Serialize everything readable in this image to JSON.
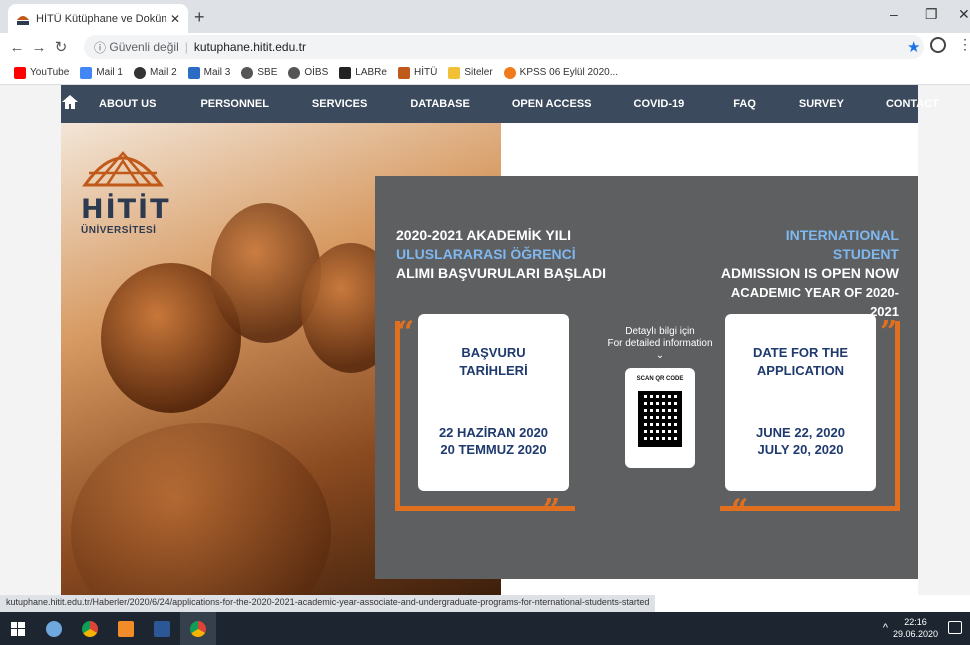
{
  "browser": {
    "tab_title": "HİTÜ Kütüphane ve Dokümantas",
    "tab_close": "✕",
    "new_tab": "+",
    "security_label": "Güvenli değil",
    "url": "kutuphane.hitit.edu.tr",
    "bookmarks": [
      {
        "label": "YouTube",
        "color": "#ff0000"
      },
      {
        "label": "Mail 1",
        "color": "#4285f4"
      },
      {
        "label": "Mail 2",
        "color": "#333333"
      },
      {
        "label": "Mail 3",
        "color": "#2b6cc4"
      },
      {
        "label": "SBE",
        "color": "#555555"
      },
      {
        "label": "OİBS",
        "color": "#555555"
      },
      {
        "label": "LABRe",
        "color": "#222222"
      },
      {
        "label": "HİTÜ",
        "color": "#c05a1a"
      },
      {
        "label": "Siteler",
        "color": "#f2c037"
      },
      {
        "label": "KPSS 06 Eylül 2020...",
        "color": "#f07b1d"
      }
    ]
  },
  "site": {
    "nav": [
      "ABOUT US",
      "PERSONNEL",
      "SERVICES",
      "DATABASE",
      "OPEN ACCESS",
      "COVID-19",
      "FAQ",
      "SURVEY",
      "CONTACT"
    ],
    "logo_name": "HİTİT",
    "logo_sub": "ÜNİVERSİTESİ"
  },
  "banner": {
    "tr_line1": "2020-2021 AKADEMİK YILI",
    "tr_line2": "ULUSLARARASI ÖĞRENCİ",
    "tr_line3": "ALIMI BAŞVURULARI BAŞLADI",
    "en_line1": "INTERNATIONAL STUDENT",
    "en_line2": "ADMISSION IS OPEN NOW",
    "en_line3": "ACADEMIC YEAR OF 2020-2021",
    "tr_card_title1": "BAŞVURU",
    "tr_card_title2": "TARİHLERİ",
    "tr_date1": "22 HAZİRAN 2020",
    "tr_date2": "20 TEMMUZ 2020",
    "en_card_title1": "DATE FOR THE",
    "en_card_title2": "APPLICATION",
    "en_date1": "JUNE 22, 2020",
    "en_date2": "JULY 20, 2020",
    "detail_tr": "Detaylı bilgi için",
    "detail_en": "For detailed information",
    "qr_label": "SCAN QR CODE"
  },
  "status_url": "kutuphane.hitit.edu.tr/Haberler/2020/6/24/applications-for-the-2020-2021-academic-year-associate-and-undergraduate-programs-for-nternational-students-started",
  "taskbar": {
    "time": "22:16",
    "date": "29.06.2020",
    "apps": [
      {
        "name": "windows-start",
        "color": "#ffffff"
      },
      {
        "name": "steam",
        "color": "#6fa8dc"
      },
      {
        "name": "chrome",
        "color": "#f4b400"
      },
      {
        "name": "vlc",
        "color": "#f28c28"
      },
      {
        "name": "word",
        "color": "#2b5797"
      },
      {
        "name": "chrome-active",
        "color": "#f4b400"
      }
    ]
  },
  "colors": {
    "accent_orange": "#e0701f",
    "nav_bg": "#3b4a5c",
    "panel_bg": "#5d5f61",
    "card_text": "#1f3a6e",
    "headline_blue": "#7fb8f0"
  }
}
